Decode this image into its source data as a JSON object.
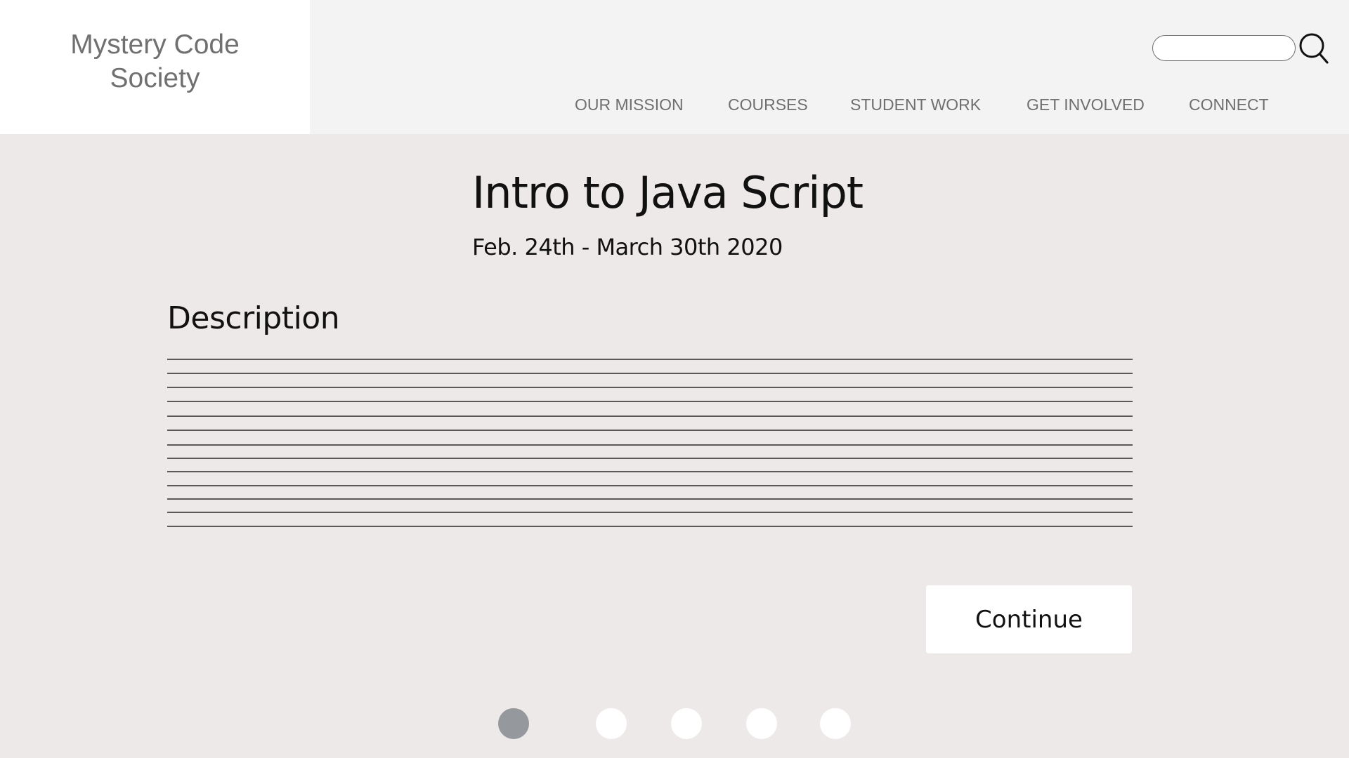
{
  "header": {
    "logo": {
      "line1": "Mystery Code",
      "line2": "Society"
    },
    "search": {
      "value": "",
      "placeholder": "",
      "icon": "search-icon"
    },
    "nav": [
      {
        "label": "OUR MISSION"
      },
      {
        "label": "COURSES"
      },
      {
        "label": "STUDENT WORK"
      },
      {
        "label": "GET INVOLVED"
      },
      {
        "label": "CONNECT"
      }
    ]
  },
  "course": {
    "title": "Intro to Java Script",
    "dates": "Feb. 24th - March 30th 2020",
    "description_heading": "Description",
    "description_placeholder_lines": 13
  },
  "actions": {
    "continue_label": "Continue"
  },
  "pagination": {
    "total": 5,
    "current": 1
  },
  "colors": {
    "page_background": "#ede9e8",
    "header_background": "#f3f3f3",
    "logo_background": "#ffffff",
    "nav_text": "#6f6f6f",
    "active_dot": "#95999d",
    "inactive_dot": "#ffffff"
  }
}
